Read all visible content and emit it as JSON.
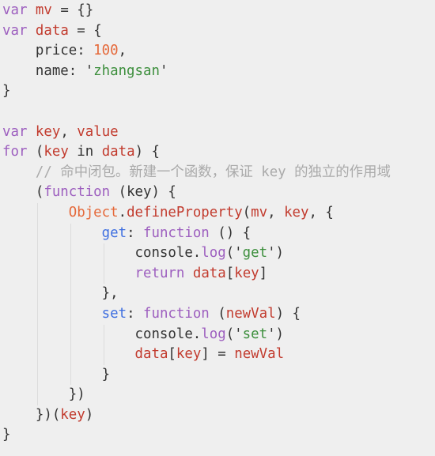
{
  "colors": {
    "background": "#efefef",
    "keyword": "#9d5fbf",
    "variable": "#c23b2e",
    "number": "#e5693a",
    "string": "#3d8f3d",
    "property": "#3f6fe0",
    "comment": "#aaaaaa",
    "text": "#333333"
  },
  "code_lines": [
    {
      "indent": 0,
      "tokens": [
        [
          "var",
          "kw"
        ],
        [
          " ",
          "pl"
        ],
        [
          "mv",
          "var"
        ],
        [
          " = {}",
          "pl"
        ]
      ]
    },
    {
      "indent": 0,
      "tokens": [
        [
          "var",
          "kw"
        ],
        [
          " ",
          "pl"
        ],
        [
          "data",
          "var"
        ],
        [
          " = {",
          "pl"
        ]
      ]
    },
    {
      "indent": 1,
      "tokens": [
        [
          "    price: ",
          "pl"
        ],
        [
          "100",
          "num"
        ],
        [
          ",",
          "pl"
        ]
      ]
    },
    {
      "indent": 1,
      "tokens": [
        [
          "    name: '",
          "pl"
        ],
        [
          "zhangsan",
          "str"
        ],
        [
          "'",
          "pl"
        ]
      ]
    },
    {
      "indent": 0,
      "tokens": [
        [
          "}",
          "pl"
        ]
      ]
    },
    {
      "indent": 0,
      "tokens": []
    },
    {
      "indent": 0,
      "tokens": [
        [
          "var",
          "kw"
        ],
        [
          " ",
          "pl"
        ],
        [
          "key",
          "var"
        ],
        [
          ", ",
          "pl"
        ],
        [
          "value",
          "var"
        ]
      ]
    },
    {
      "indent": 0,
      "tokens": [
        [
          "for",
          "kw"
        ],
        [
          " (",
          "pl"
        ],
        [
          "key",
          "var"
        ],
        [
          " in ",
          "pl"
        ],
        [
          "data",
          "var"
        ],
        [
          ") {",
          "pl"
        ]
      ]
    },
    {
      "indent": 1,
      "tokens": [
        [
          "    ",
          "pl"
        ],
        [
          "// 命中闭包。新建一个函数，保证 key 的独立的作用域",
          "cm"
        ]
      ]
    },
    {
      "indent": 1,
      "tokens": [
        [
          "    (",
          "pl"
        ],
        [
          "function",
          "kw"
        ],
        [
          " (key) {",
          "pl"
        ]
      ]
    },
    {
      "indent": 2,
      "tokens": [
        [
          "        ",
          "pl"
        ],
        [
          "Object",
          "obj"
        ],
        [
          ".",
          "pl"
        ],
        [
          "defineProperty",
          "var"
        ],
        [
          "(",
          "pl"
        ],
        [
          "mv",
          "var"
        ],
        [
          ", ",
          "pl"
        ],
        [
          "key",
          "var"
        ],
        [
          ", {",
          "pl"
        ]
      ]
    },
    {
      "indent": 3,
      "tokens": [
        [
          "            ",
          "pl"
        ],
        [
          "get",
          "prop"
        ],
        [
          ": ",
          "pl"
        ],
        [
          "function",
          "kw"
        ],
        [
          " () {",
          "pl"
        ]
      ]
    },
    {
      "indent": 4,
      "tokens": [
        [
          "                console.",
          "pl"
        ],
        [
          "log",
          "kw"
        ],
        [
          "('",
          "pl"
        ],
        [
          "get",
          "str"
        ],
        [
          "')",
          "pl"
        ]
      ]
    },
    {
      "indent": 4,
      "tokens": [
        [
          "                ",
          "pl"
        ],
        [
          "return",
          "kw"
        ],
        [
          " ",
          "pl"
        ],
        [
          "data",
          "var"
        ],
        [
          "[",
          "pl"
        ],
        [
          "key",
          "var"
        ],
        [
          "]",
          "pl"
        ]
      ]
    },
    {
      "indent": 3,
      "tokens": [
        [
          "            },",
          "pl"
        ]
      ]
    },
    {
      "indent": 3,
      "tokens": [
        [
          "            ",
          "pl"
        ],
        [
          "set",
          "prop"
        ],
        [
          ": ",
          "pl"
        ],
        [
          "function",
          "kw"
        ],
        [
          " (",
          "pl"
        ],
        [
          "newVal",
          "var"
        ],
        [
          ") {",
          "pl"
        ]
      ]
    },
    {
      "indent": 4,
      "tokens": [
        [
          "                console.",
          "pl"
        ],
        [
          "log",
          "kw"
        ],
        [
          "('",
          "pl"
        ],
        [
          "set",
          "str"
        ],
        [
          "')",
          "pl"
        ]
      ]
    },
    {
      "indent": 4,
      "tokens": [
        [
          "                ",
          "pl"
        ],
        [
          "data",
          "var"
        ],
        [
          "[",
          "pl"
        ],
        [
          "key",
          "var"
        ],
        [
          "] = ",
          "pl"
        ],
        [
          "newVal",
          "var"
        ]
      ]
    },
    {
      "indent": 3,
      "tokens": [
        [
          "            }",
          "pl"
        ]
      ]
    },
    {
      "indent": 2,
      "tokens": [
        [
          "        })",
          "pl"
        ]
      ]
    },
    {
      "indent": 1,
      "tokens": [
        [
          "    })(",
          "pl"
        ],
        [
          "key",
          "var"
        ],
        [
          ")",
          "pl"
        ]
      ]
    },
    {
      "indent": 0,
      "tokens": [
        [
          "}",
          "pl"
        ]
      ]
    }
  ]
}
